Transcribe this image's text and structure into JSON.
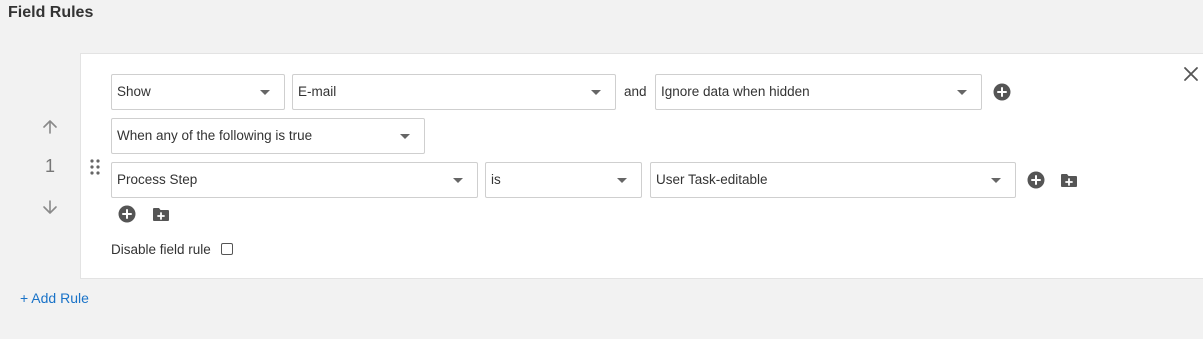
{
  "header": {
    "title": "Field Rules"
  },
  "rule": {
    "index": "1",
    "action": "Show",
    "field": "E-mail",
    "connector": "and",
    "hidden_behavior": "Ignore data when hidden",
    "condition_mode": "When any of the following is true",
    "condition": {
      "field": "Process Step",
      "operator": "is",
      "value": "User Task-editable"
    },
    "disable_label": "Disable field rule",
    "disabled": false
  },
  "footer": {
    "add_rule_label": "+ Add Rule"
  },
  "colors": {
    "link": "#1a73c8",
    "icon": "#555555",
    "border": "#cfcfcf"
  },
  "icons": [
    "close-icon",
    "arrow-up-icon",
    "arrow-down-icon",
    "drag-handle-icon",
    "plus-circle-icon",
    "folder-plus-icon"
  ]
}
